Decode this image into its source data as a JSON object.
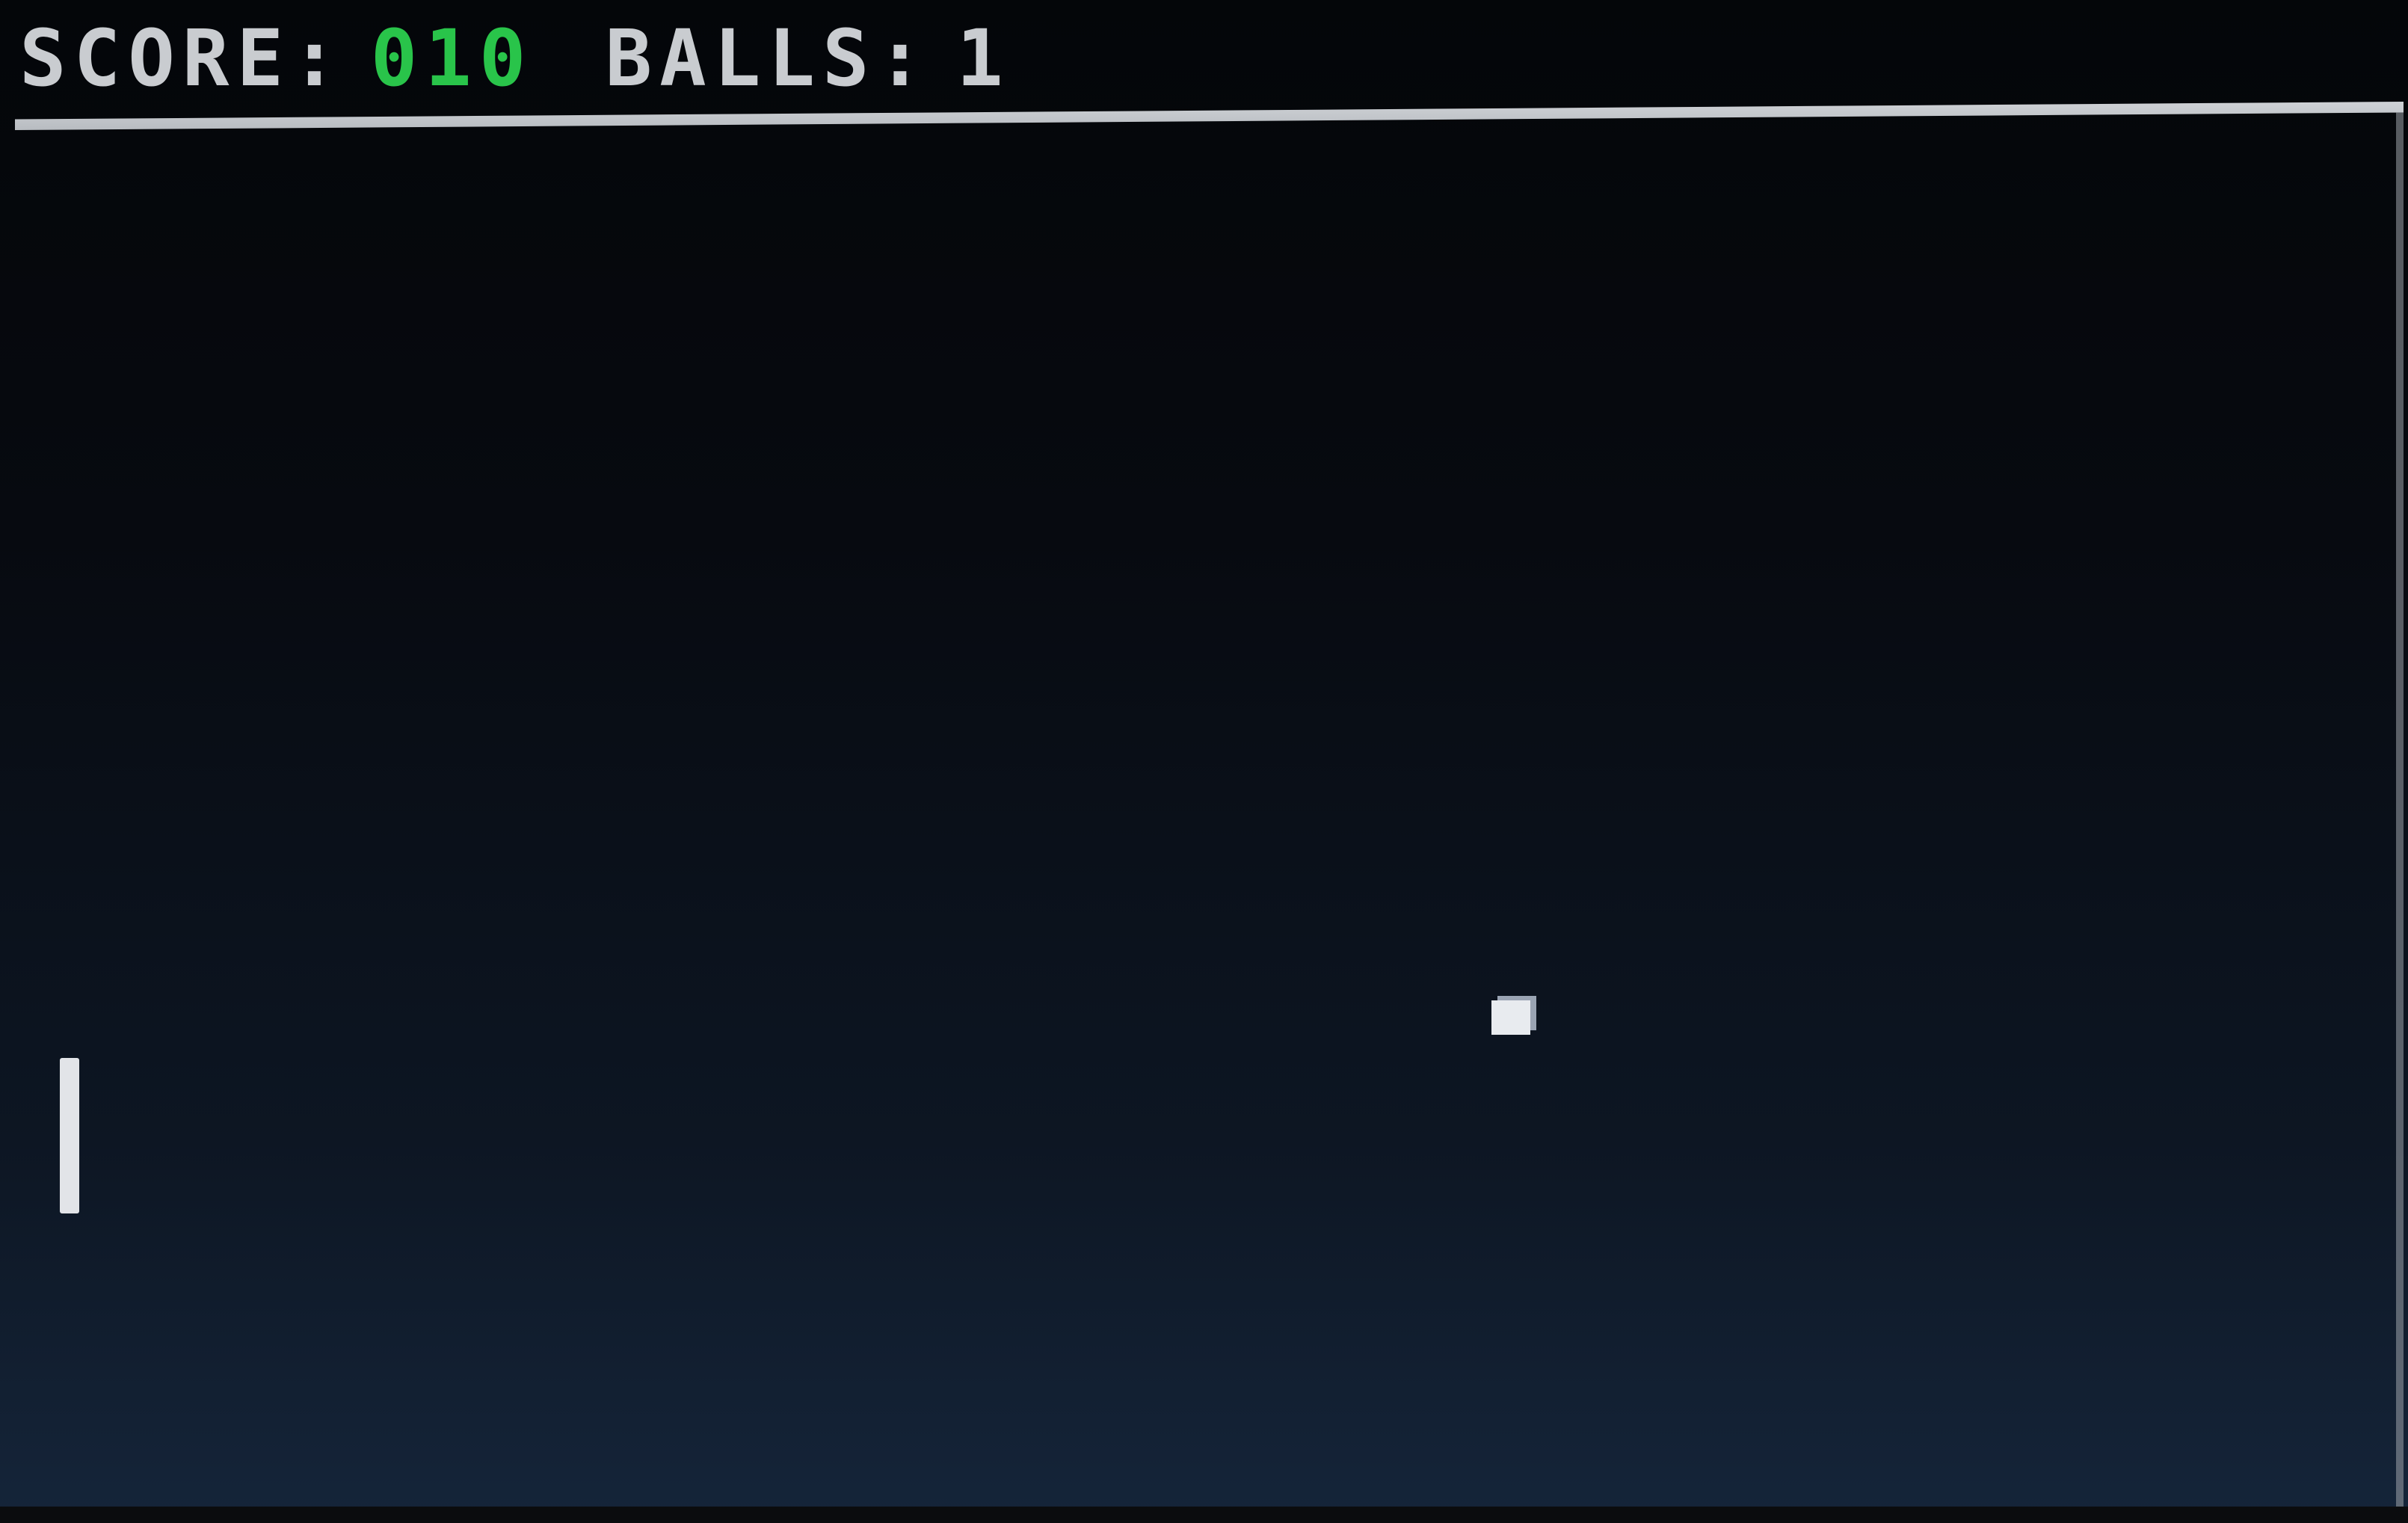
{
  "hud": {
    "score_label": "SCORE:",
    "score_value": "010",
    "balls_label": "BALLS:",
    "balls_value": "1"
  },
  "colors": {
    "hud_text": "#c9ccd0",
    "score_value": "#29c44a",
    "background_top": "#040609",
    "background_bottom": "#15253a",
    "paddle": "#e2e4e8",
    "ball": "#e8ebef"
  }
}
